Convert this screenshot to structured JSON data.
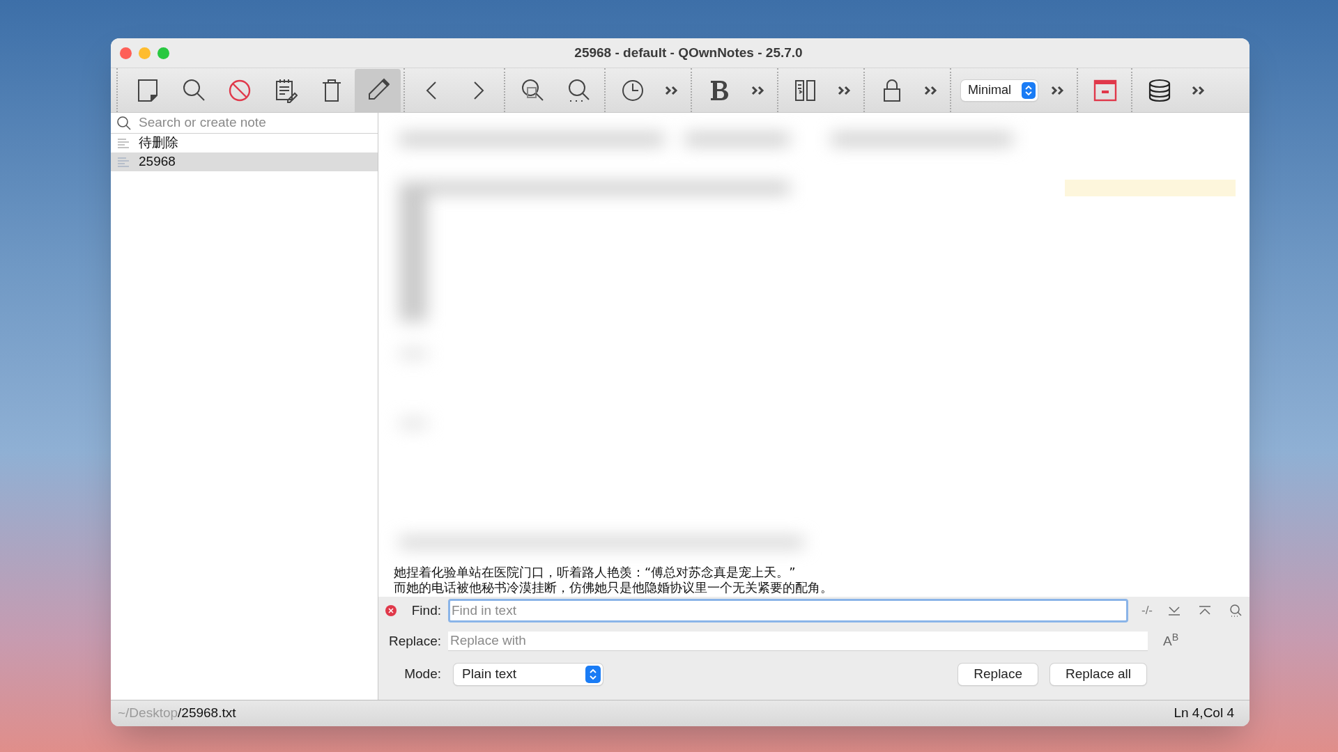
{
  "window": {
    "title": "25968 - default - QOwnNotes - 25.7.0"
  },
  "toolbar": {
    "groups": [
      [
        {
          "kind": "button",
          "on": false
        },
        {
          "kind": "button",
          "on": false
        },
        {
          "kind": "button",
          "on": false
        },
        {
          "kind": "button",
          "on": false
        },
        {
          "kind": "button",
          "on": false
        },
        {
          "kind": "button",
          "on": true
        }
      ],
      [
        {
          "kind": "button",
          "on": false
        },
        {
          "kind": "button",
          "on": false
        }
      ],
      [
        {
          "kind": "button",
          "on": false
        },
        {
          "kind": "button",
          "on": false
        }
      ],
      [
        {
          "kind": "button",
          "on": false
        },
        {
          "kind": "overflow"
        }
      ],
      [
        {
          "kind": "button",
          "on": false
        },
        {
          "kind": "overflow"
        }
      ],
      [
        {
          "kind": "button",
          "on": false
        },
        {
          "kind": "overflow"
        }
      ],
      [
        {
          "kind": "button",
          "on": false
        },
        {
          "kind": "overflow"
        }
      ],
      [
        {
          "kind": "dropdown",
          "value": "Minimal"
        },
        {
          "kind": "overflow"
        }
      ],
      [
        {
          "kind": "button",
          "on": false
        }
      ],
      [
        {
          "kind": "button",
          "on": false
        },
        {
          "kind": "overflow"
        }
      ]
    ]
  },
  "note_search": {
    "placeholder": "Search or create note"
  },
  "notes": [
    {
      "title": "待删除",
      "selected": false
    },
    {
      "title": "25968",
      "selected": true
    }
  ],
  "editor": {
    "lines": [
      "她捏着化验单站在医院门口，听着路人艳羡：“傅总对苏念真是宠上天。”",
      "而她的电话被他秘书冷漠挂断，仿佛她只是他隐婚协议里一个无关紧要的配角。"
    ]
  },
  "find_bar": {
    "find_label": "Find:",
    "find_placeholder": "Find in text",
    "regex_toggle": "-/-",
    "replace_label": "Replace:",
    "replace_placeholder": "Replace with",
    "case_toggle": "A$^{B}$",
    "mode_label": "Mode:",
    "mode": "Plain text",
    "buttons": [
      "Replace",
      "Replace all"
    ]
  },
  "status_bar": {
    "folder": "~/Desktop",
    "file": "/25968.txt",
    "position": "Ln 4,Col 4"
  }
}
